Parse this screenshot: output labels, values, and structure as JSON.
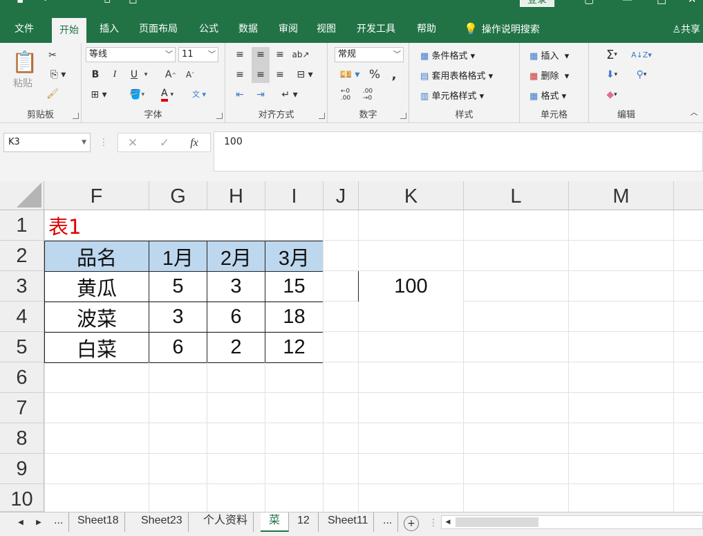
{
  "titlebar": {
    "login": "登录"
  },
  "tabs": [
    "文件",
    "开始",
    "插入",
    "页面布局",
    "公式",
    "数据",
    "审阅",
    "视图",
    "开发工具",
    "帮助",
    "操作说明搜索"
  ],
  "share": "共享",
  "ribbon": {
    "clipboard": {
      "label": "剪贴板",
      "paste": "粘贴"
    },
    "font": {
      "label": "字体",
      "name": "等线",
      "size": "11",
      "bold": "B",
      "italic": "I",
      "underline": "U"
    },
    "alignment": {
      "label": "对齐方式"
    },
    "number": {
      "label": "数字",
      "format": "常规",
      "percent": "%",
      "comma": ","
    },
    "styles": {
      "label": "样式",
      "items": [
        "条件格式",
        "套用表格格式",
        "单元格样式"
      ]
    },
    "cells": {
      "label": "单元格",
      "items": [
        "插入",
        "删除",
        "格式"
      ]
    },
    "editing": {
      "label": "编辑"
    }
  },
  "formula_bar": {
    "name_box": "K3",
    "content": "100"
  },
  "columns": [
    "F",
    "G",
    "H",
    "I",
    "J",
    "K",
    "L",
    "M"
  ],
  "rows": [
    "1",
    "2",
    "3",
    "4",
    "5",
    "6",
    "7",
    "8",
    "9",
    "10"
  ],
  "cells": {
    "title": "表1",
    "headers": [
      "品名",
      "1月",
      "2月",
      "3月"
    ],
    "table": [
      [
        "黄瓜",
        "5",
        "3",
        "15"
      ],
      [
        "波菜",
        "3",
        "6",
        "18"
      ],
      [
        "白菜",
        "6",
        "2",
        "12"
      ]
    ],
    "k3": "100"
  },
  "sheet_tabs": [
    "...",
    "Sheet18",
    "Sheet23",
    "个人资料",
    "菜",
    "12",
    "Sheet11",
    "..."
  ],
  "active_sheet": "菜",
  "colors": {
    "accent": "#217346",
    "header_fill": "#bdd7ee",
    "title_red": "#e00000"
  }
}
